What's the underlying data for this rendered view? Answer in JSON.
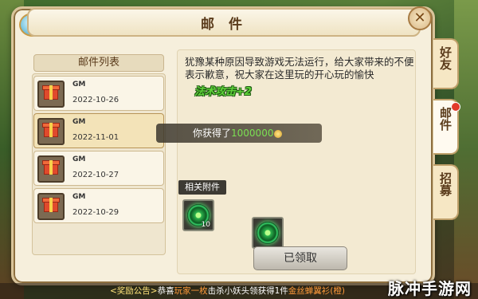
{
  "window": {
    "title": "邮 件"
  },
  "side_tabs": [
    {
      "label": "好友"
    },
    {
      "label": "邮件"
    },
    {
      "label": "招募"
    }
  ],
  "mail_list": {
    "header": "邮件列表",
    "items": [
      {
        "sender": "GM",
        "date": "2022-10-26",
        "icon": "gift-box-icon"
      },
      {
        "sender": "GM",
        "date": "2022-11-01",
        "icon": "gift-box-icon"
      },
      {
        "sender": "GM",
        "date": "2022-10-27",
        "icon": "gift-box-icon"
      },
      {
        "sender": "GM",
        "date": "2022-10-29",
        "icon": "gift-box-icon"
      }
    ],
    "selected_index": 1
  },
  "mail_content": {
    "body": "犹豫某种原因导致游戏无法运行，给大家带来的不便表示歉意，祝大家在这里玩的开心玩的愉快",
    "buff_popup": "法术攻击+2"
  },
  "reward_toast": {
    "prefix": "你获得了",
    "amount": "1000000",
    "icon": "coin-icon"
  },
  "attachments": {
    "label": "相关附件",
    "items": [
      {
        "icon": "green-swirl-orb-icon",
        "count": "10"
      },
      {
        "icon": "green-swirl-orb-icon",
        "count": ""
      }
    ]
  },
  "claim_button": {
    "label": "已领取"
  },
  "announcement": {
    "tag": "<奖励公告>",
    "text_before": "恭喜",
    "player": "玩家一枚",
    "text_middle": "击杀小妖头领获得1件",
    "item": "金丝蝉翼衫(橙)"
  },
  "watermark": "脉冲手游网",
  "colors": {
    "panel_bg": "#f6efdc",
    "buff_green": "#5fd33a",
    "accent_red": "#e23a2b"
  }
}
